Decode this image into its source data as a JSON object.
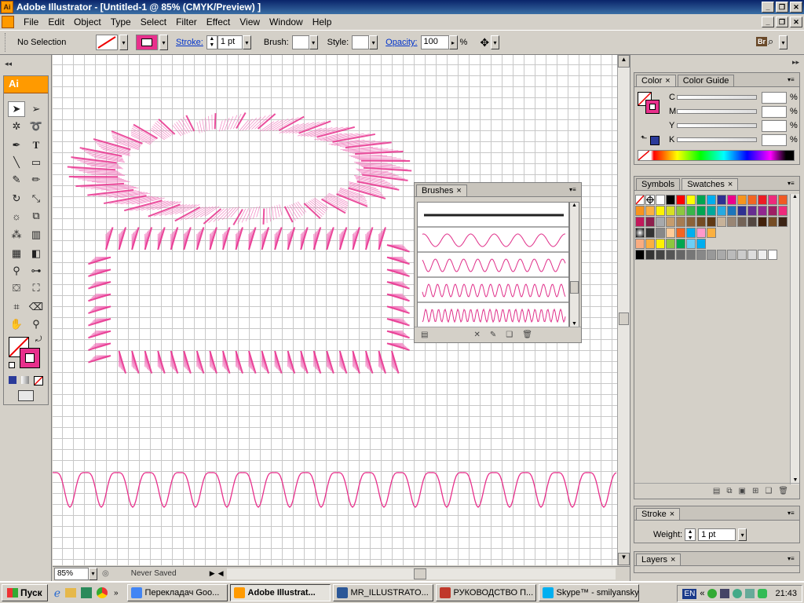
{
  "app": {
    "title": "Adobe Illustrator - [Untitled-1 @ 85% (CMYK/Preview) ]",
    "icon": "Ai"
  },
  "menu": [
    "File",
    "Edit",
    "Object",
    "Type",
    "Select",
    "Filter",
    "Effect",
    "View",
    "Window",
    "Help"
  ],
  "control_bar": {
    "selection": "No Selection",
    "stroke_label": "Stroke:",
    "stroke_value": "1 pt",
    "brush_label": "Brush:",
    "style_label": "Style:",
    "opacity_label": "Opacity:",
    "opacity_value": "100",
    "percent": "%",
    "bridge": "Br"
  },
  "toolbox": {
    "logo": "Ai"
  },
  "brushes_panel": {
    "tab": "Brushes",
    "brush_colors": [
      "#222222",
      "#e0308a",
      "#e0308a",
      "#e0308a",
      "#e0308a"
    ]
  },
  "color_panel": {
    "tabs": [
      "Color",
      "Color Guide"
    ],
    "channels": [
      {
        "label": "C",
        "value": "",
        "unit": "%"
      },
      {
        "label": "M",
        "value": "",
        "unit": "%"
      },
      {
        "label": "Y",
        "value": "",
        "unit": "%"
      },
      {
        "label": "K",
        "value": "",
        "unit": "%"
      }
    ]
  },
  "swatches_panel": {
    "tabs": [
      "Symbols",
      "Swatches"
    ]
  },
  "stroke_panel": {
    "tab": "Stroke",
    "weight_label": "Weight:",
    "weight_value": "1 pt"
  },
  "layers_panel": {
    "tab": "Layers"
  },
  "status": {
    "zoom": "85%",
    "save_state": "Never Saved"
  },
  "taskbar": {
    "start": "Пуск",
    "buttons": [
      {
        "label": "Перекладач Goo...",
        "icon_color": "#4285f4"
      },
      {
        "label": "Adobe Illustrat...",
        "icon_color": "#ff9a00",
        "active": true
      },
      {
        "label": "MR_ILLUSTRATO...",
        "icon_color": "#2b5797"
      },
      {
        "label": "РУКОВОДСТВО П...",
        "icon_color": "#c0392b"
      },
      {
        "label": "Skype™ - smilyansky",
        "icon_color": "#00aff0"
      }
    ],
    "lang": "EN",
    "clock": "21:43"
  },
  "colors": {
    "accent_pink": "#e8308c",
    "brush_pink": "#f070b8"
  }
}
